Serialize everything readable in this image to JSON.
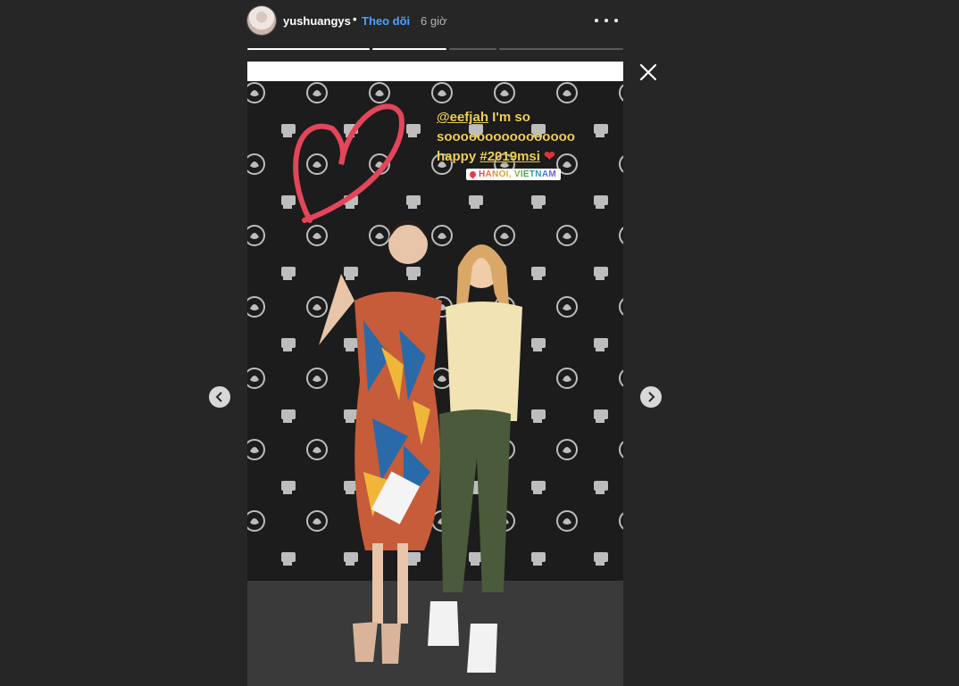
{
  "header": {
    "username": "yushuangys",
    "separator": "•",
    "follow_label": "Theo dõi",
    "time_ago": "6 giờ"
  },
  "story": {
    "caption": {
      "mention": "@eefjah",
      "text1": " I'm so",
      "text2": "soooooooooooooooo",
      "text3": "happy",
      "hashtag": "#2019msi",
      "heart": "❤"
    },
    "location": "HANOI, VIETNAM",
    "progress": {
      "segments": 3,
      "current": 2
    }
  },
  "icons": {
    "prev": "chevron-left-icon",
    "next": "chevron-right-icon",
    "close": "close-icon",
    "more": "more-options-icon"
  },
  "colors": {
    "background": "#262626",
    "follow": "#4aa3ff",
    "caption": "#f0cf55",
    "heart": "#e0313b"
  }
}
